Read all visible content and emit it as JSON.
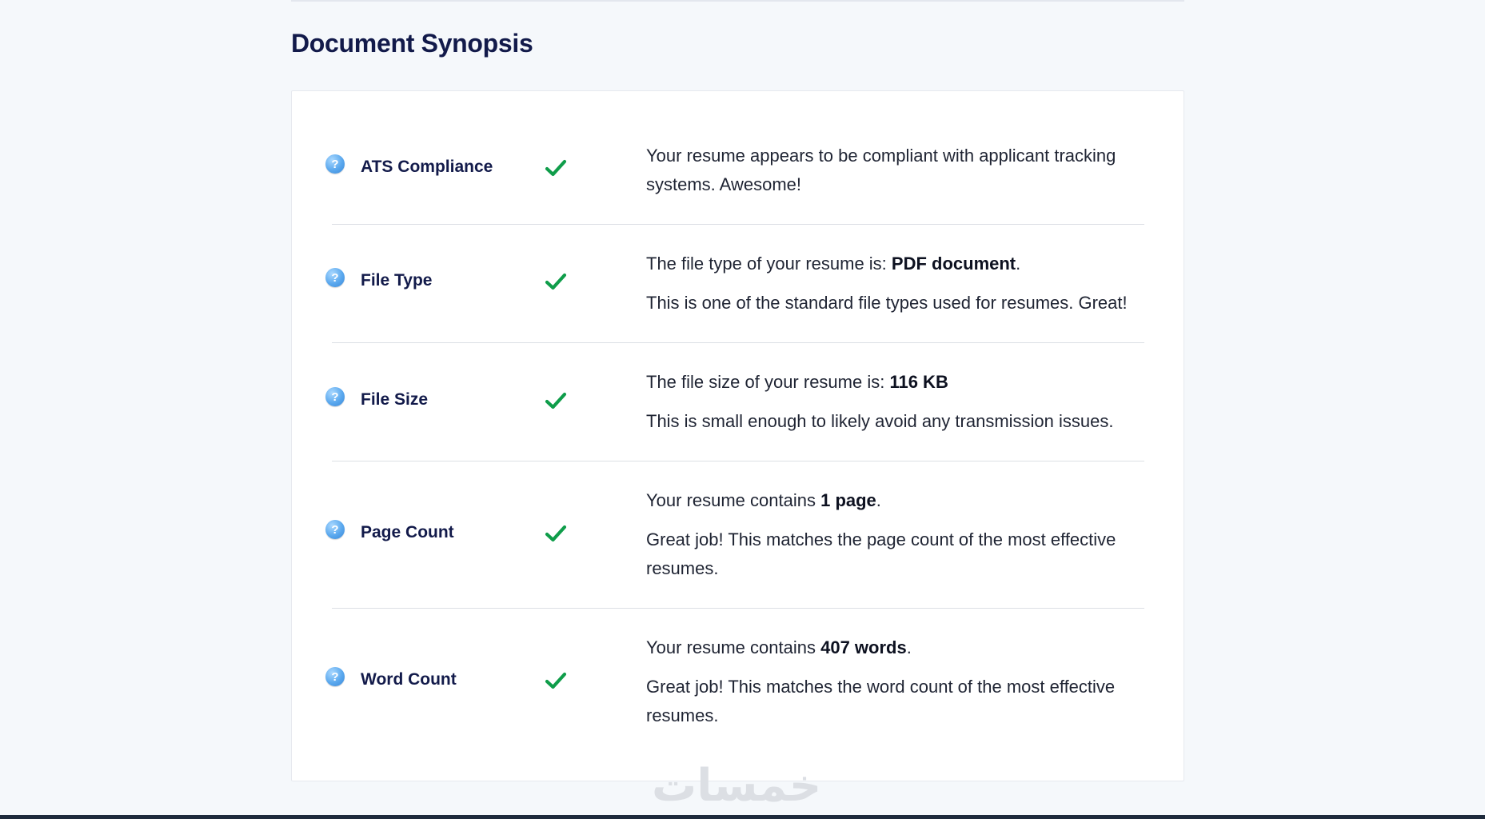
{
  "page_title": "Document Synopsis",
  "icons": {
    "help": "question-circle-icon",
    "status": "check-icon"
  },
  "colors": {
    "title": "#121a4a",
    "check": "#0f9d4a",
    "help": "#4a9be6"
  },
  "help_glyph": "?",
  "rows": [
    {
      "label": "ATS Compliance",
      "line1_pre": "Your resume appears to be compliant with applicant tracking systems. Awesome!",
      "line1_bold": "",
      "line1_post": "",
      "line2": ""
    },
    {
      "label": "File Type",
      "line1_pre": "The file type of your resume is: ",
      "line1_bold": "PDF document",
      "line1_post": ".",
      "line2": "This is one of the standard file types used for resumes. Great!"
    },
    {
      "label": "File Size",
      "line1_pre": "The file size of your resume is: ",
      "line1_bold": "116 KB",
      "line1_post": "",
      "line2": "This is small enough to likely avoid any transmission issues."
    },
    {
      "label": "Page Count",
      "line1_pre": "Your resume contains ",
      "line1_bold": "1 page",
      "line1_post": ".",
      "line2": "Great job! This matches the page count of the most effective resumes."
    },
    {
      "label": "Word Count",
      "line1_pre": "Your resume contains ",
      "line1_bold": "407 words",
      "line1_post": ".",
      "line2": "Great job! This matches the word count of the most effective resumes."
    }
  ],
  "watermark": "خمسات"
}
